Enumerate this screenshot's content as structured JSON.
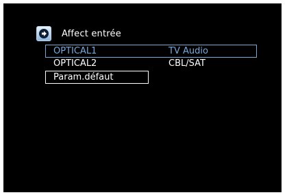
{
  "screen": {
    "title": "Affect entrée",
    "title_icon": "forward-arrow-icon",
    "accent_color": "#79a9dc",
    "background_color": "#000000"
  },
  "rows": [
    {
      "label": "OPTICAL1",
      "value": "TV Audio",
      "state": "highlighted"
    },
    {
      "label": "OPTICAL2",
      "value": "CBL/SAT",
      "state": "normal"
    }
  ],
  "reset": {
    "label": "Param.défaut",
    "state": "selected"
  }
}
